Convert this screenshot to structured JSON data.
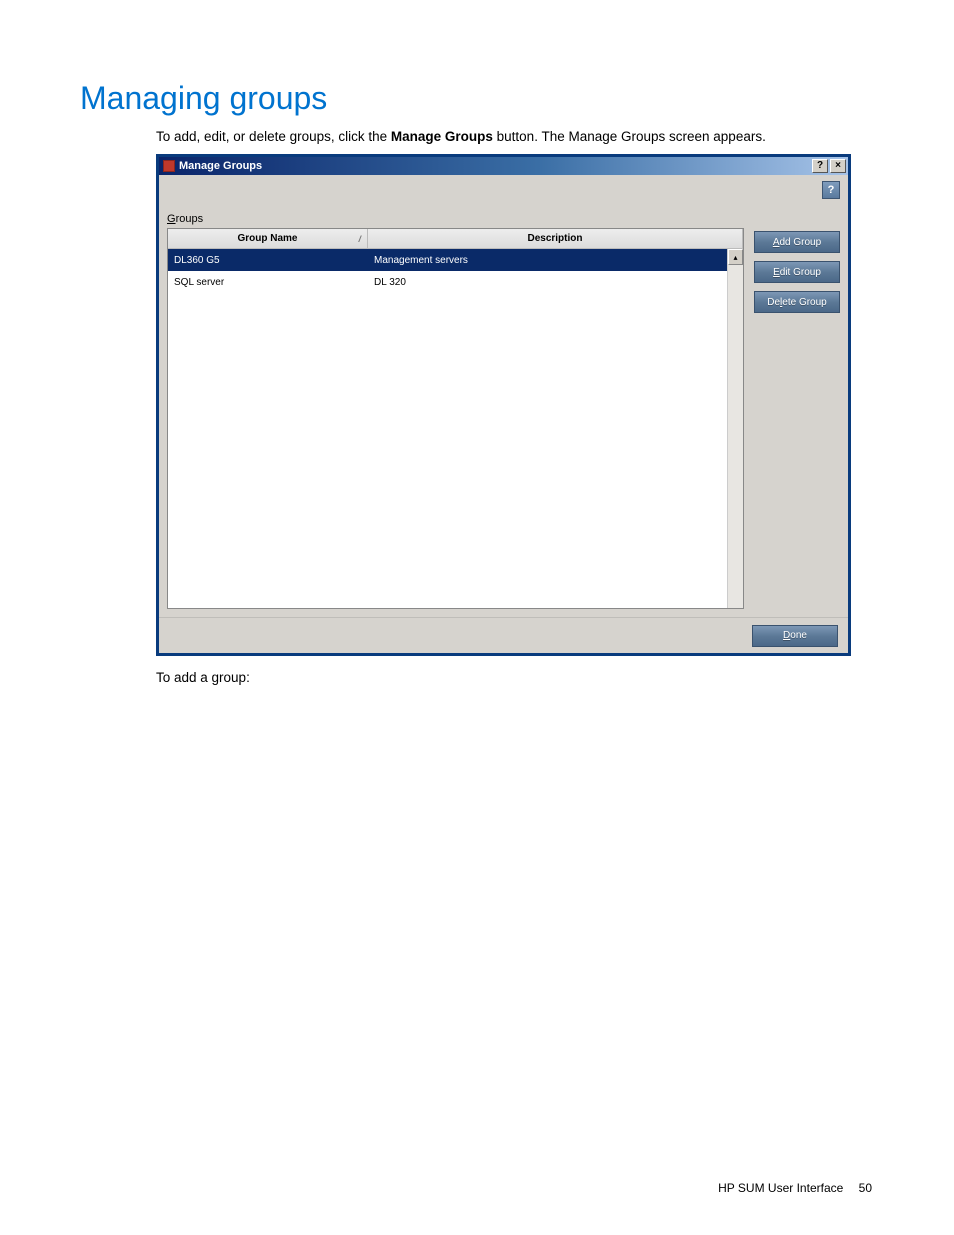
{
  "heading": "Managing groups",
  "intro_prefix": "To add, edit, or delete groups, click the ",
  "intro_bold": "Manage Groups",
  "intro_suffix": " button. The Manage Groups screen appears.",
  "dialog": {
    "title": "Manage Groups",
    "help_btn": "?",
    "close_btn": "×",
    "body_help": "?",
    "groups_label_prefix": "G",
    "groups_label_rest": "roups",
    "columns": {
      "group_name": "Group Name",
      "description": "Description",
      "sort_marker": "/"
    },
    "rows": [
      {
        "name": "DL360 G5",
        "desc": "Management servers",
        "selected": true
      },
      {
        "name": "SQL server",
        "desc": "DL 320",
        "selected": false
      }
    ],
    "buttons": {
      "add_prefix": "A",
      "add_rest": "dd Group",
      "edit_prefix": "E",
      "edit_rest": "dit Group",
      "delete_prefix": "De",
      "delete_mn": "l",
      "delete_rest": "ete Group",
      "done_prefix": "D",
      "done_rest": "one"
    },
    "scroll_up": "▴"
  },
  "post_text": "To add a group:",
  "footer": {
    "label": "HP SUM User Interface",
    "page": "50"
  }
}
